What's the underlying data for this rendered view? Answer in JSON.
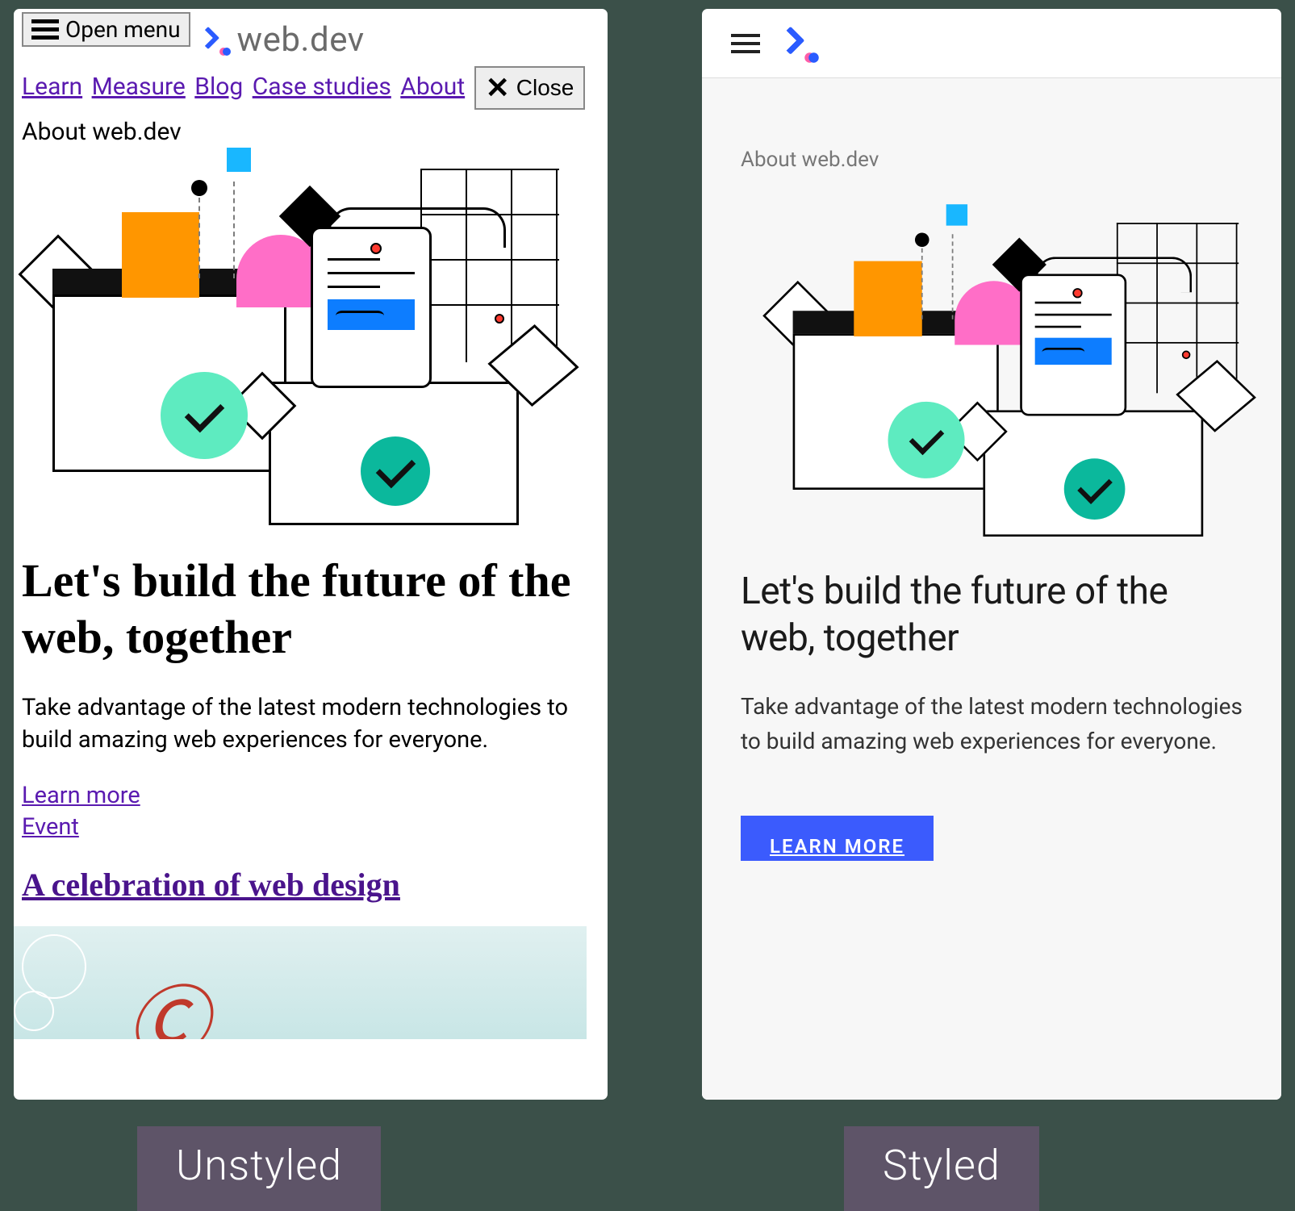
{
  "captions": {
    "unstyled": "Unstyled",
    "styled": "Styled"
  },
  "unstyled": {
    "open_menu": "Open menu",
    "site_name": "web.dev",
    "nav": {
      "learn": "Learn",
      "measure": "Measure",
      "blog": "Blog",
      "case_studies": "Case studies",
      "about": "About"
    },
    "close": "Close",
    "breadcrumb": "About web.dev",
    "headline": "Let's build the future of the web, together",
    "subhead": "Take advantage of the latest modern technologies to build amazing web experiences for everyone.",
    "learn_more": "Learn more",
    "event": "Event",
    "article_title": "A celebration of web design"
  },
  "styled": {
    "breadcrumb": "About web.dev",
    "headline": "Let's build the future of the web, together",
    "subhead": "Take advantage of the latest modern technologies to build amazing web experiences for everyone.",
    "cta": "LEARN MORE"
  },
  "colors": {
    "brand_blue": "#3b5bfd",
    "bg": "#3b5049"
  }
}
